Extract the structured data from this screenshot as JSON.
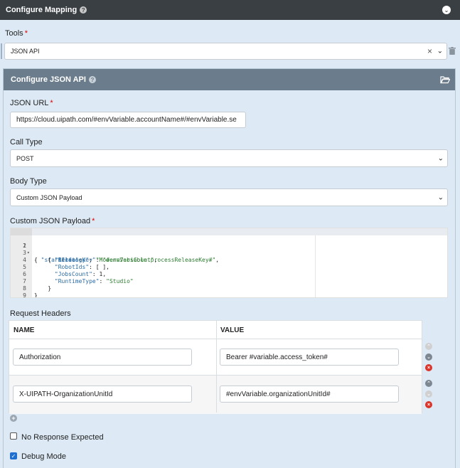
{
  "header": {
    "title": "Configure Mapping"
  },
  "tools": {
    "label": "Tools",
    "required_mark": "*",
    "value": "JSON API",
    "clear_glyph": "×",
    "caret_glyph": "⌄"
  },
  "panel": {
    "title": "Configure JSON API"
  },
  "json_url": {
    "label": "JSON URL",
    "required_mark": "*",
    "value": "https://cloud.uipath.com/#envVariable.accountName#/#envVariable.se"
  },
  "call_type": {
    "label": "Call Type",
    "value": "POST"
  },
  "body_type": {
    "label": "Body Type",
    "value": "Custom JSON Payload"
  },
  "payload": {
    "label": "Custom JSON Payload",
    "required_mark": "*",
    "line_numbers": [
      "1",
      "2",
      "3",
      "4",
      "5",
      "6",
      "7",
      "8",
      "9"
    ],
    "fold_marks": [
      "▾",
      "▾"
    ]
  },
  "request_headers": {
    "label": "Request Headers",
    "col_name": "NAME",
    "col_value": "VALUE",
    "rows": [
      {
        "name": "Authorization",
        "value": "Bearer #variable.access_token#"
      },
      {
        "name": "X-UIPATH-OrganizationUnitId",
        "value": "#envVariable.organizationUnitId#"
      }
    ]
  },
  "options": {
    "no_response_label": "No Response Expected",
    "no_response_checked": false,
    "debug_label": "Debug Mode",
    "debug_checked": true
  },
  "colors": {
    "header_bg": "#3a3f44",
    "panel_header_bg": "#6b7c8c",
    "page_bg": "#ddeaf5",
    "accent_blue": "#1f6fd1",
    "delete_red": "#d9352a"
  },
  "icons": [
    "help-icon",
    "collapse-icon",
    "trash-icon",
    "folder-open-icon",
    "move-up-icon",
    "move-down-icon",
    "delete-icon",
    "add-row-icon",
    "checkbox-icon"
  ]
}
